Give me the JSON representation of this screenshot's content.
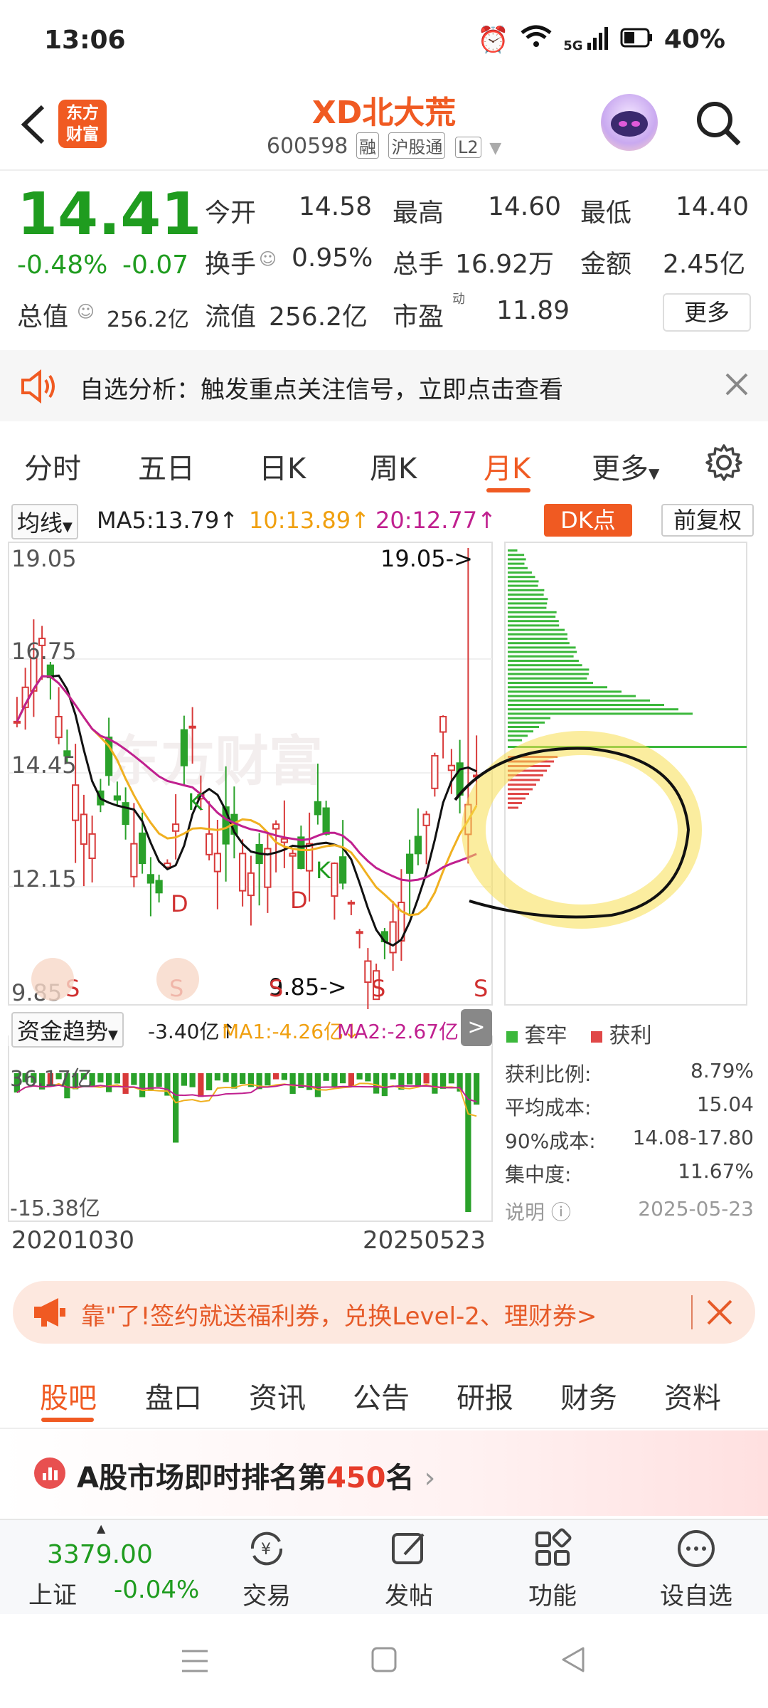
{
  "status_bar": {
    "time": "13:06",
    "battery": "40%",
    "network": "5G"
  },
  "header": {
    "logo_text_1": "东方",
    "logo_text_2": "财富",
    "title": "XD北大荒",
    "code": "600598",
    "tag_rong": "融",
    "tag_hgt": "沪股通",
    "tag_l2": "L2"
  },
  "quote": {
    "price": "14.41",
    "change_pct": "-0.48%",
    "change": "-0.07",
    "open_label": "今开",
    "open": "14.58",
    "high_label": "最高",
    "high": "14.60",
    "low_label": "最低",
    "low": "14.40",
    "turnover_label": "换手",
    "turnover": "0.95%",
    "volume_label": "总手",
    "volume": "16.92万",
    "amount_label": "金额",
    "amount": "2.45亿",
    "total_cap_label": "总值",
    "total_cap": "256.2亿",
    "float_cap_label": "流值",
    "float_cap": "256.2亿",
    "pe_label": "市盈",
    "pe_sup": "动",
    "pe": "11.89",
    "more": "更多"
  },
  "notice": {
    "text": "自选分析：触发重点关注信号，立即点击查看"
  },
  "tabs": [
    "分时",
    "五日",
    "日K",
    "周K",
    "月K",
    "更多"
  ],
  "active_tab": "月K",
  "chart_bar": {
    "indicator": "均线",
    "ma5": "MA5:13.79↑",
    "ma10": "10:13.89↑",
    "ma20": "20:12.77↑",
    "dk": "DK点",
    "adjust": "前复权"
  },
  "price_axis": [
    "19.05",
    "16.75",
    "14.45",
    "12.15",
    "9.85"
  ],
  "marks": {
    "high_marker": "19.05->",
    "low_marker": "9.85->",
    "d": "D",
    "k": "K",
    "s": "S",
    "watermark": "东方财富"
  },
  "capital": {
    "indicator": "资金趋势",
    "value": "-3.40亿↑",
    "ma1": "MA1:-4.26亿↓",
    "ma2": "MA2:-2.67亿↓",
    "top_label": "36.17亿",
    "bottom_label": "-15.38亿",
    "start_date": "20201030",
    "end_date": "20250523"
  },
  "chip_stats": {
    "legend_trapped": "套牢",
    "legend_profit": "获利",
    "profit_ratio_label": "获利比例:",
    "profit_ratio": "8.79%",
    "avg_cost_label": "平均成本:",
    "avg_cost": "15.04",
    "cost90_label": "90%成本:",
    "cost90": "14.08-17.80",
    "concentration_label": "集中度:",
    "concentration": "11.67%",
    "note": "说明",
    "date": "2025-05-23"
  },
  "banner": {
    "text": "靠\"了!签约就送福利券，兑换Level-2、理财券>"
  },
  "bottom_tabs": [
    "股吧",
    "盘口",
    "资讯",
    "公告",
    "研报",
    "财务",
    "资料"
  ],
  "rank": {
    "prefix": "A股市场即时排名第",
    "num": "450",
    "suffix": "名"
  },
  "toolbar": {
    "index_value": "3379.00",
    "index_name": "上证",
    "index_change": "-0.04%",
    "trade": "交易",
    "post": "发帖",
    "func": "功能",
    "watch": "设自选"
  },
  "colors": {
    "brand": "#f05a22",
    "up": "#e63c2a",
    "down": "#1f9c1f"
  }
}
